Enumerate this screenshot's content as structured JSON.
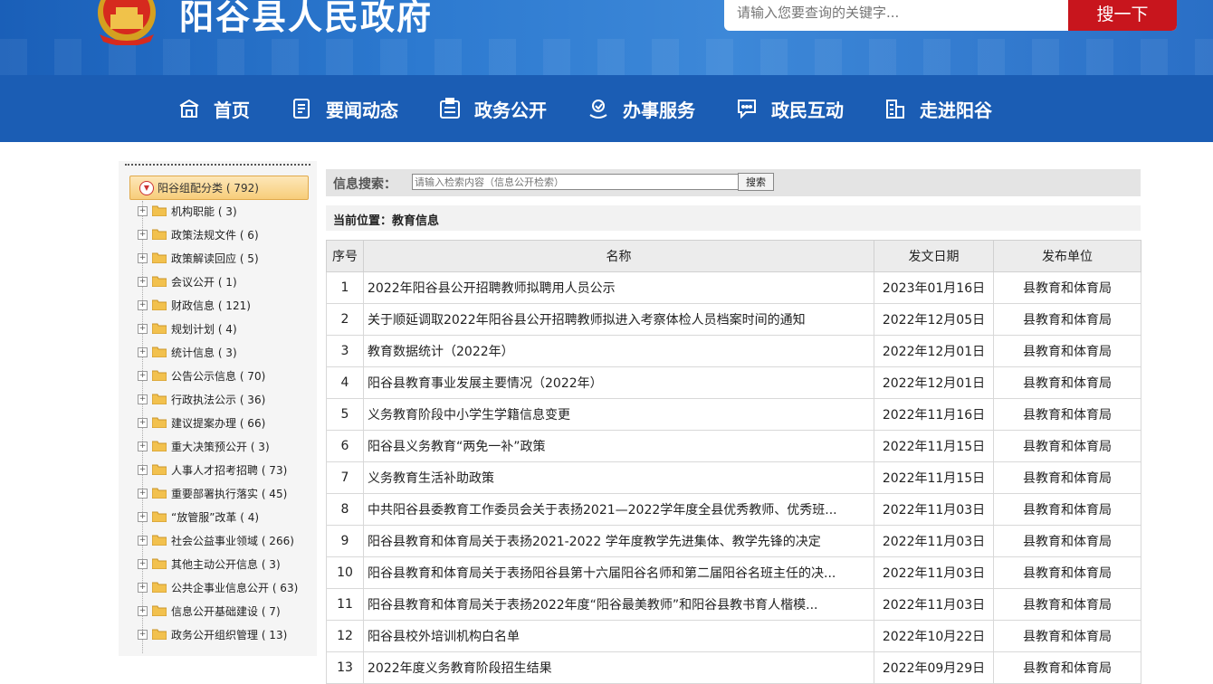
{
  "header": {
    "site_title": "阳谷县人民政府",
    "search_placeholder": "请输入您要查询的关键字...",
    "search_button": "搜一下"
  },
  "nav": [
    {
      "label": "首页",
      "icon": "home-icon"
    },
    {
      "label": "要闻动态",
      "icon": "news-icon"
    },
    {
      "label": "政务公开",
      "icon": "gov-open-icon"
    },
    {
      "label": "办事服务",
      "icon": "service-icon"
    },
    {
      "label": "政民互动",
      "icon": "chat-icon"
    },
    {
      "label": "走进阳谷",
      "icon": "building-icon"
    }
  ],
  "sidebar": {
    "root_label": "阳谷组配分类 ( 792)",
    "items": [
      "机构职能 ( 3)",
      "政策法规文件 ( 6)",
      "政策解读回应 ( 5)",
      "会议公开 ( 1)",
      "财政信息 ( 121)",
      "规划计划 ( 4)",
      "统计信息 ( 3)",
      "公告公示信息 ( 70)",
      "行政执法公示 ( 36)",
      "建议提案办理 ( 66)",
      "重大决策预公开 ( 3)",
      "人事人才招考招聘 ( 73)",
      "重要部署执行落实 ( 45)",
      "“放管服”改革 ( 4)",
      "社会公益事业领域 ( 266)",
      "其他主动公开信息 ( 3)",
      "公共企事业信息公开 ( 63)",
      "信息公开基础建设 ( 7)",
      "政务公开组织管理 ( 13)"
    ]
  },
  "info_search": {
    "label": "信息搜索：",
    "placeholder": "请输入检索内容（信息公开检索）",
    "button": "搜索"
  },
  "breadcrumb": "当前位置：教育信息",
  "table": {
    "headers": [
      "序号",
      "名称",
      "发文日期",
      "发布单位"
    ],
    "rows": [
      {
        "no": "1",
        "title": "2022年阳谷县公开招聘教师拟聘用人员公示",
        "date": "2023年01月16日",
        "org": "县教育和体育局"
      },
      {
        "no": "2",
        "title": "关于顺延调取2022年阳谷县公开招聘教师拟进入考察体检人员档案时间的通知",
        "date": "2022年12月05日",
        "org": "县教育和体育局"
      },
      {
        "no": "3",
        "title": "教育数据统计（2022年）",
        "date": "2022年12月01日",
        "org": "县教育和体育局"
      },
      {
        "no": "4",
        "title": "阳谷县教育事业发展主要情况（2022年）",
        "date": "2022年12月01日",
        "org": "县教育和体育局"
      },
      {
        "no": "5",
        "title": "义务教育阶段中小学生学籍信息变更",
        "date": "2022年11月16日",
        "org": "县教育和体育局"
      },
      {
        "no": "6",
        "title": "阳谷县义务教育“两免一补”政策",
        "date": "2022年11月15日",
        "org": "县教育和体育局"
      },
      {
        "no": "7",
        "title": "义务教育生活补助政策",
        "date": "2022年11月15日",
        "org": "县教育和体育局"
      },
      {
        "no": "8",
        "title": "中共阳谷县委教育工作委员会关于表扬2021—2022学年度全县优秀教师、优秀班...",
        "date": "2022年11月03日",
        "org": "县教育和体育局"
      },
      {
        "no": "9",
        "title": "阳谷县教育和体育局关于表扬2021-2022 学年度教学先进集体、教学先锋的决定",
        "date": "2022年11月03日",
        "org": "县教育和体育局"
      },
      {
        "no": "10",
        "title": "阳谷县教育和体育局关于表扬阳谷县第十六届阳谷名师和第二届阳谷名班主任的决...",
        "date": "2022年11月03日",
        "org": "县教育和体育局"
      },
      {
        "no": "11",
        "title": "阳谷县教育和体育局关于表扬2022年度“阳谷最美教师”和阳谷县教书育人楷模...",
        "date": "2022年11月03日",
        "org": "县教育和体育局"
      },
      {
        "no": "12",
        "title": "阳谷县校外培训机构白名单",
        "date": "2022年10月22日",
        "org": "县教育和体育局"
      },
      {
        "no": "13",
        "title": "2022年度义务教育阶段招生结果",
        "date": "2022年09月29日",
        "org": "县教育和体育局"
      }
    ]
  },
  "colors": {
    "nav_bg": "#1b5db4",
    "search_btn": "#c8151d"
  }
}
